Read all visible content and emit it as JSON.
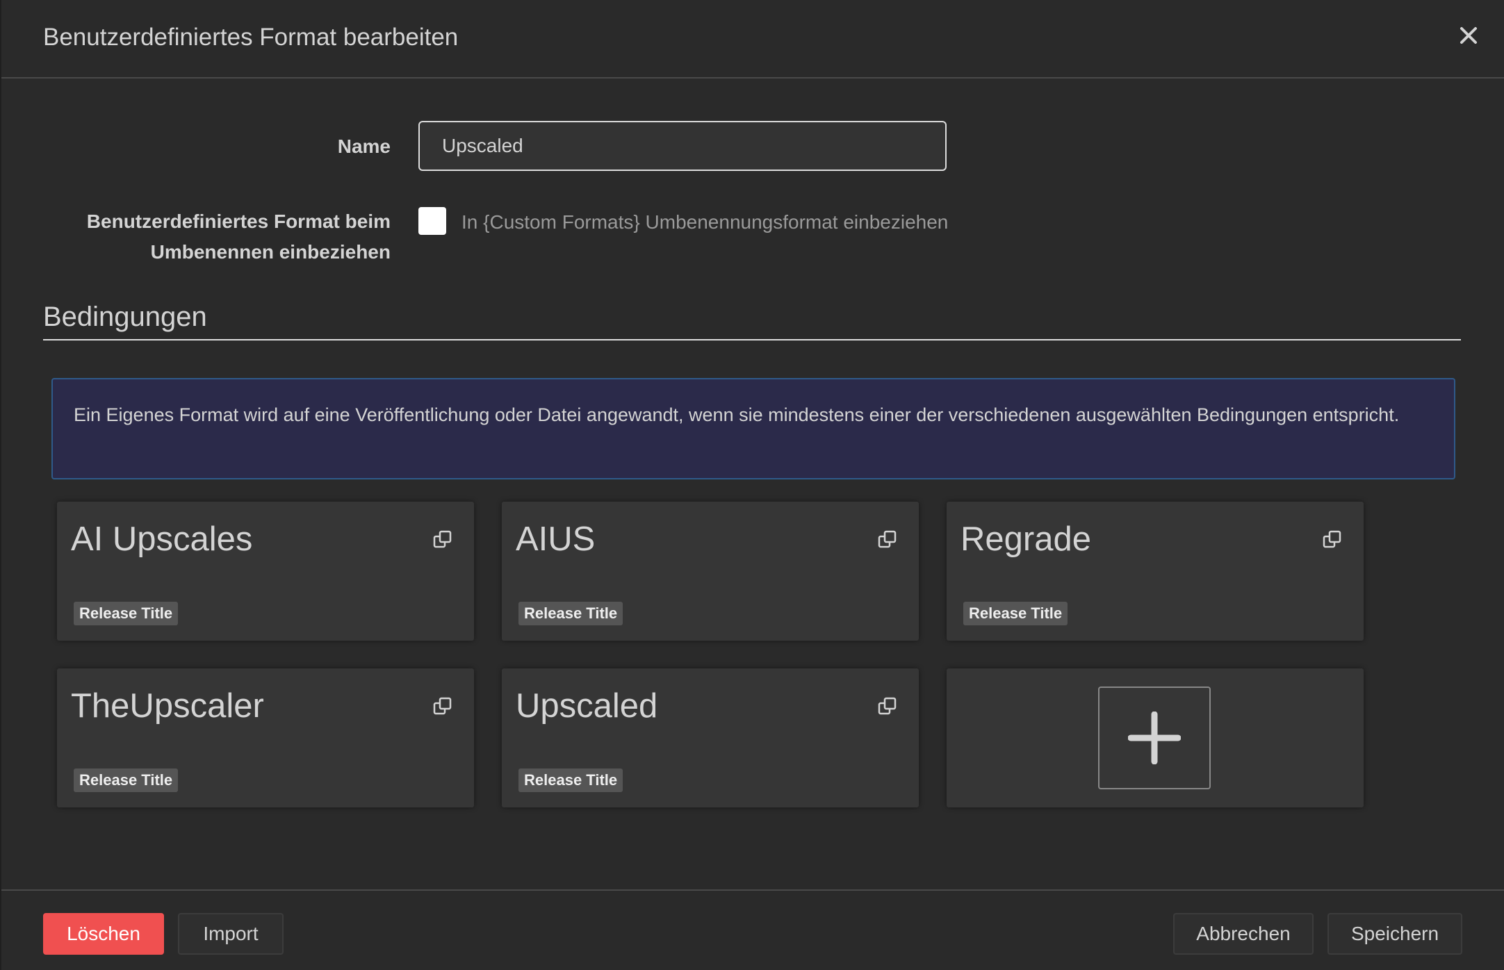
{
  "modal": {
    "title": "Benutzerdefiniertes Format bearbeiten"
  },
  "form": {
    "name_label": "Name",
    "name_value": "Upscaled",
    "rename_label_line1": "Benutzerdefiniertes Format beim",
    "rename_label_line2": "Umbenennen einbeziehen",
    "rename_checked": false,
    "rename_help": "In {Custom Formats} Umbenennungsformat einbeziehen"
  },
  "conditions": {
    "legend": "Bedingungen",
    "info_text": "Ein Eigenes Format wird auf eine Veröffentlichung oder Datei angewandt, wenn sie mindestens einer der verschiedenen ausgewählten Bedingungen entspricht.",
    "items": [
      {
        "name": "AI Upscales",
        "type": "Release Title"
      },
      {
        "name": "AIUS",
        "type": "Release Title"
      },
      {
        "name": "Regrade",
        "type": "Release Title"
      },
      {
        "name": "TheUpscaler",
        "type": "Release Title"
      },
      {
        "name": "Upscaled",
        "type": "Release Title"
      }
    ]
  },
  "footer": {
    "delete_label": "Löschen",
    "import_label": "Import",
    "cancel_label": "Abbrechen",
    "save_label": "Speichern"
  },
  "colors": {
    "danger": "#f05050",
    "info_bg": "#2b2a4a",
    "info_border": "#2f5a8a"
  },
  "icons": {
    "close": "close-icon",
    "clone": "clone-icon",
    "add": "plus-icon"
  }
}
